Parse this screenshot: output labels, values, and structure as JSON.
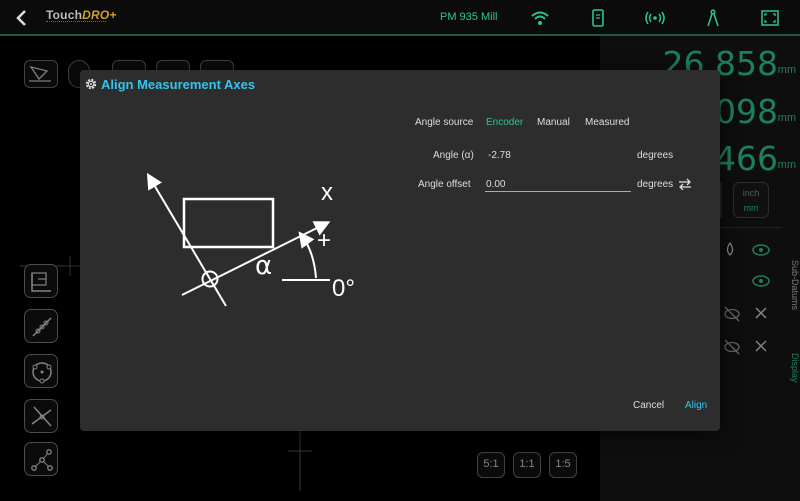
{
  "topbar": {
    "logo_main": "Touch",
    "logo_pro": "DRO+",
    "machine_name": "PM 935 Mill",
    "icons": [
      "back-arrow-icon",
      "wifi-icon",
      "tablet-icon",
      "signal-icon",
      "compass-icon",
      "fullscreen-icon"
    ]
  },
  "readouts": {
    "x": "26.858",
    "y": "098",
    "z": "466",
    "unit": "mm",
    "inch_label": "inch",
    "mm_label": "mm"
  },
  "side_tabs": {
    "sub_datums": "Sub-Datums",
    "display": "Display"
  },
  "zoom": [
    "5:1",
    "1:1",
    "1:5"
  ],
  "dialog": {
    "title": "Align Measurement Axes",
    "angle_source_label": "Angle source",
    "sources": [
      "Encoder",
      "Manual",
      "Measured"
    ],
    "active_source": "Encoder",
    "angle_label": "Angle (α)",
    "angle_value": "-2.78",
    "angle_unit": "degrees",
    "offset_label": "Angle offset",
    "offset_value": "0.00",
    "offset_unit": "degrees",
    "cancel": "Cancel",
    "align": "Align",
    "diagram": {
      "x_label": "x",
      "plus_label": "+",
      "alpha_label": "α",
      "zero_label": "0°"
    }
  },
  "colors": {
    "accent_green": "#2ec48f",
    "accent_blue": "#35c4ee",
    "dialog_bg": "#2d2d2d"
  }
}
